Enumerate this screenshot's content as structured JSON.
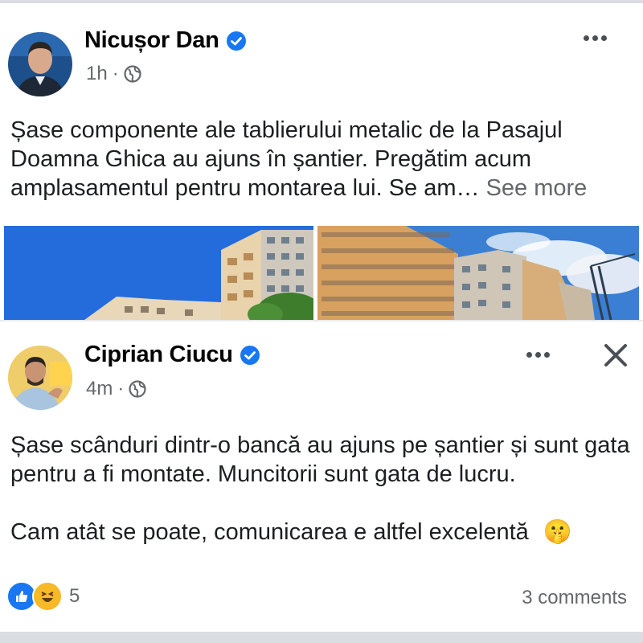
{
  "post1": {
    "author": "Nicușor Dan",
    "time": "1h",
    "separator": "·",
    "text": "Șase componente ale tablierului metalic de la Pasajul Doamna Ghica au ajuns în șantier. Pregătim acum amplasamentul pentru montarea lui. Se am…",
    "see_more": "See more"
  },
  "post2": {
    "author": "Ciprian Ciucu",
    "time": "4m",
    "separator": "·",
    "paragraph1": "Șase scânduri dintr-o bancă au ajuns pe șantier și sunt gata pentru a fi montate. Muncitorii sunt gata de lucru.",
    "paragraph2": "Cam atât se poate, comunicarea e altfel excelentă",
    "emoji": "🤫",
    "reaction_count": "5",
    "comments": "3 comments"
  },
  "icons": {
    "verified": "verified-badge-icon",
    "globe": "globe-icon",
    "more": "more-dots-icon",
    "close": "close-icon",
    "like": "like-reaction-icon",
    "haha": "haha-reaction-icon"
  },
  "colors": {
    "verified_blue": "#1877f2",
    "secondary_text": "#65676b",
    "like_blue": "#1877f2",
    "haha_yellow": "#f7b928"
  }
}
